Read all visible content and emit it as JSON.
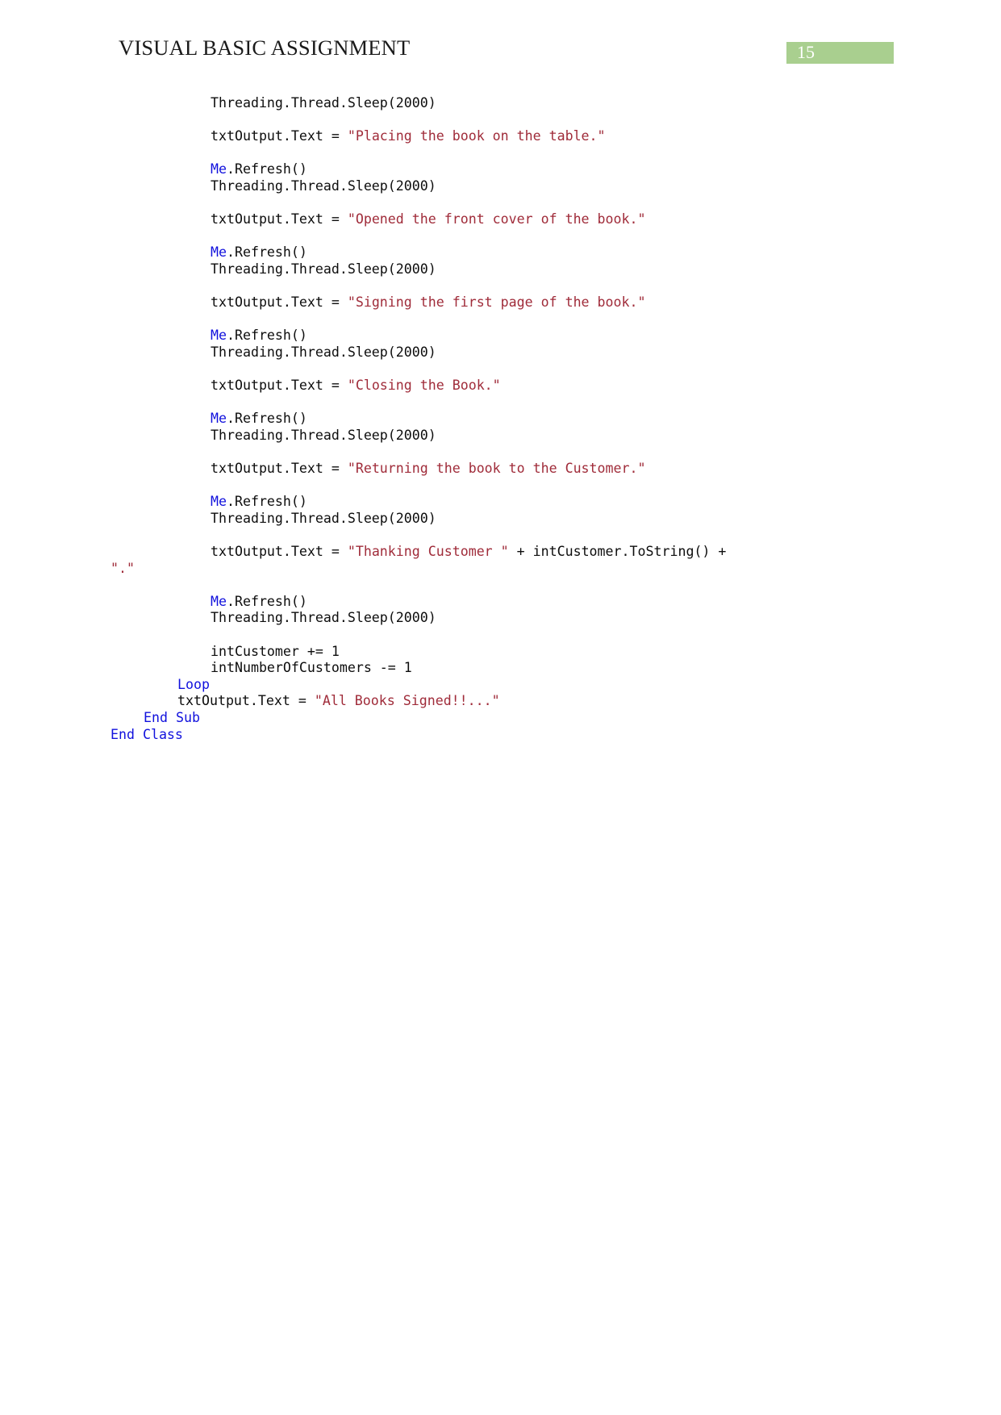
{
  "header": {
    "title": "VISUAL BASIC ASSIGNMENT",
    "page_number": "15",
    "badge_color": "#a9cf8f",
    "badge_text_color": "#ffffff"
  },
  "colors": {
    "string_literal": "#a02c3a",
    "keyword": "#1111dd",
    "plain_text": "#0d0d0d",
    "page_background": "#ffffff"
  },
  "code": {
    "language": "Visual Basic .NET",
    "lines": [
      {
        "indent": 12,
        "segments": [
          {
            "t": "Threading.Thread.Sleep(2000)",
            "k": "plain"
          }
        ]
      },
      {
        "indent": 0,
        "blank": true,
        "segments": []
      },
      {
        "indent": 12,
        "segments": [
          {
            "t": "txtOutput.Text = ",
            "k": "plain"
          },
          {
            "t": "\"Placing the book on the table.\"",
            "k": "str"
          }
        ]
      },
      {
        "indent": 0,
        "blank": true,
        "segments": []
      },
      {
        "indent": 12,
        "segments": [
          {
            "t": "Me",
            "k": "kw"
          },
          {
            "t": ".Refresh()",
            "k": "plain"
          }
        ]
      },
      {
        "indent": 12,
        "segments": [
          {
            "t": "Threading.Thread.Sleep(2000)",
            "k": "plain"
          }
        ]
      },
      {
        "indent": 0,
        "blank": true,
        "segments": []
      },
      {
        "indent": 12,
        "segments": [
          {
            "t": "txtOutput.Text = ",
            "k": "plain"
          },
          {
            "t": "\"Opened the front cover of the book.\"",
            "k": "str"
          }
        ]
      },
      {
        "indent": 0,
        "blank": true,
        "segments": []
      },
      {
        "indent": 12,
        "segments": [
          {
            "t": "Me",
            "k": "kw"
          },
          {
            "t": ".Refresh()",
            "k": "plain"
          }
        ]
      },
      {
        "indent": 12,
        "segments": [
          {
            "t": "Threading.Thread.Sleep(2000)",
            "k": "plain"
          }
        ]
      },
      {
        "indent": 0,
        "blank": true,
        "segments": []
      },
      {
        "indent": 12,
        "segments": [
          {
            "t": "txtOutput.Text = ",
            "k": "plain"
          },
          {
            "t": "\"Signing the first page of the book.\"",
            "k": "str"
          }
        ]
      },
      {
        "indent": 0,
        "blank": true,
        "segments": []
      },
      {
        "indent": 12,
        "segments": [
          {
            "t": "Me",
            "k": "kw"
          },
          {
            "t": ".Refresh()",
            "k": "plain"
          }
        ]
      },
      {
        "indent": 12,
        "segments": [
          {
            "t": "Threading.Thread.Sleep(2000)",
            "k": "plain"
          }
        ]
      },
      {
        "indent": 0,
        "blank": true,
        "segments": []
      },
      {
        "indent": 12,
        "segments": [
          {
            "t": "txtOutput.Text = ",
            "k": "plain"
          },
          {
            "t": "\"Closing the Book.\"",
            "k": "str"
          }
        ]
      },
      {
        "indent": 0,
        "blank": true,
        "segments": []
      },
      {
        "indent": 12,
        "segments": [
          {
            "t": "Me",
            "k": "kw"
          },
          {
            "t": ".Refresh()",
            "k": "plain"
          }
        ]
      },
      {
        "indent": 12,
        "segments": [
          {
            "t": "Threading.Thread.Sleep(2000)",
            "k": "plain"
          }
        ]
      },
      {
        "indent": 0,
        "blank": true,
        "segments": []
      },
      {
        "indent": 12,
        "segments": [
          {
            "t": "txtOutput.Text = ",
            "k": "plain"
          },
          {
            "t": "\"Returning the book to the Customer.\"",
            "k": "str"
          }
        ]
      },
      {
        "indent": 0,
        "blank": true,
        "segments": []
      },
      {
        "indent": 12,
        "segments": [
          {
            "t": "Me",
            "k": "kw"
          },
          {
            "t": ".Refresh()",
            "k": "plain"
          }
        ]
      },
      {
        "indent": 12,
        "segments": [
          {
            "t": "Threading.Thread.Sleep(2000)",
            "k": "plain"
          }
        ]
      },
      {
        "indent": 0,
        "blank": true,
        "segments": []
      },
      {
        "indent": 12,
        "segments": [
          {
            "t": "txtOutput.Text = ",
            "k": "plain"
          },
          {
            "t": "\"Thanking Customer \"",
            "k": "str"
          },
          {
            "t": " + intCustomer.ToString() +",
            "k": "plain"
          }
        ]
      },
      {
        "indent": 0,
        "segments": [
          {
            "t": "\".\"",
            "k": "str"
          }
        ]
      },
      {
        "indent": 0,
        "blank": true,
        "segments": []
      },
      {
        "indent": 12,
        "segments": [
          {
            "t": "Me",
            "k": "kw"
          },
          {
            "t": ".Refresh()",
            "k": "plain"
          }
        ]
      },
      {
        "indent": 12,
        "segments": [
          {
            "t": "Threading.Thread.Sleep(2000)",
            "k": "plain"
          }
        ]
      },
      {
        "indent": 0,
        "blank": true,
        "segments": []
      },
      {
        "indent": 12,
        "segments": [
          {
            "t": "intCustomer += 1",
            "k": "plain"
          }
        ]
      },
      {
        "indent": 12,
        "segments": [
          {
            "t": "intNumberOfCustomers -= 1",
            "k": "plain"
          }
        ]
      },
      {
        "indent": 8,
        "segments": [
          {
            "t": "Loop",
            "k": "kw"
          }
        ]
      },
      {
        "indent": 8,
        "segments": [
          {
            "t": "txtOutput.Text = ",
            "k": "plain"
          },
          {
            "t": "\"All Books Signed!!...\"",
            "k": "str"
          }
        ]
      },
      {
        "indent": 4,
        "segments": [
          {
            "t": "End Sub",
            "k": "kw"
          }
        ]
      },
      {
        "indent": 0,
        "segments": [
          {
            "t": "End Class",
            "k": "kw"
          }
        ]
      }
    ]
  }
}
